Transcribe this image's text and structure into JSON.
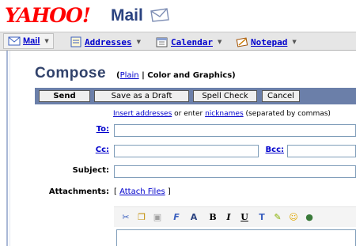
{
  "brand": {
    "logo_text": "YAHOO!",
    "product": "Mail",
    "envelope_icon": "envelope-icon"
  },
  "tabs": [
    {
      "label": "Mail",
      "icon": "mail-envelope-icon",
      "active": true
    },
    {
      "label": "Addresses",
      "icon": "address-book-icon",
      "active": false
    },
    {
      "label": "Calendar",
      "icon": "calendar-icon",
      "active": false
    },
    {
      "label": "Notepad",
      "icon": "notepad-icon",
      "active": false
    }
  ],
  "compose": {
    "title": "Compose",
    "mode_open": "(",
    "mode_plain": "Plain",
    "mode_sep": " | ",
    "mode_rich": "Color and Graphics",
    "mode_close": ")"
  },
  "actions": {
    "send": "Send",
    "save_draft": "Save as a Draft",
    "spell_check": "Spell Check",
    "cancel": "Cancel"
  },
  "helper": {
    "insert_link": "Insert addresses",
    "middle": " or enter ",
    "nick_link": "nicknames",
    "tail": " (separated by commas)"
  },
  "form": {
    "to_label": "To:",
    "to_value": "",
    "cc_label": "Cc:",
    "cc_value": "",
    "bcc_label": "Bcc:",
    "bcc_value": "",
    "subject_label": "Subject:",
    "subject_value": "",
    "attachments_label": "Attachments:",
    "attach_open": "[ ",
    "attach_link": "Attach Files",
    "attach_close": " ]"
  },
  "formatting": [
    {
      "icon": "cut-icon",
      "glyph": "✂",
      "color": "#3a5fbf"
    },
    {
      "icon": "copy-icon",
      "glyph": "❐",
      "color": "#c08a00"
    },
    {
      "icon": "paste-icon",
      "glyph": "▣",
      "color": "#a0a0a0"
    },
    {
      "icon": "font-face-icon",
      "glyph": "F",
      "color": "#3a5fbf"
    },
    {
      "icon": "font-size-icon",
      "glyph": "A",
      "color": "#2a4280"
    },
    {
      "icon": "bold-icon",
      "glyph": "B",
      "color": "#000000"
    },
    {
      "icon": "italic-icon",
      "glyph": "I",
      "color": "#000000"
    },
    {
      "icon": "underline-icon",
      "glyph": "U",
      "color": "#000000"
    },
    {
      "icon": "text-color-icon",
      "glyph": "T",
      "color": "#3a5fbf"
    },
    {
      "icon": "highlight-icon",
      "glyph": "✎",
      "color": "#88b000"
    },
    {
      "icon": "emoticon-icon",
      "glyph": "☺",
      "color": "#e0a800"
    },
    {
      "icon": "image-icon",
      "glyph": "●",
      "color": "#3a7a3a"
    }
  ],
  "colors": {
    "brand_red": "#ff0000",
    "brand_blue": "#2a4280",
    "action_bar": "#6b7fa9",
    "link": "#0000cc"
  }
}
